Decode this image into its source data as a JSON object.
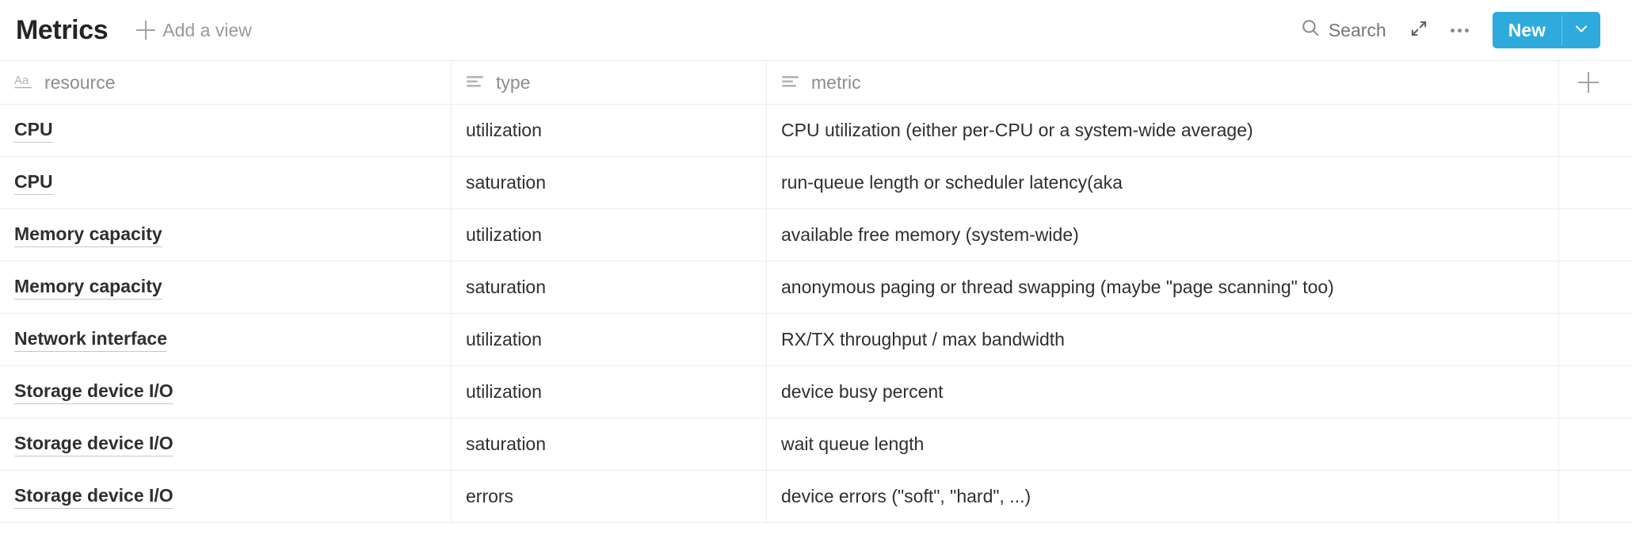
{
  "toolbar": {
    "view_title": "Metrics",
    "add_view_label": "Add a view",
    "add_view_icon": "plus-icon",
    "search_label": "Search",
    "search_icon": "search-icon",
    "expand_icon": "expand-diagonal-arrows-icon",
    "more_icon": "ellipsis-icon",
    "new_label": "New",
    "new_caret_icon": "chevron-down-icon",
    "accent_color": "#2eaadc"
  },
  "table": {
    "columns": [
      {
        "label": "resource",
        "icon": "title-text-aa-icon",
        "type": "title"
      },
      {
        "label": "type",
        "icon": "text-property-icon",
        "type": "text"
      },
      {
        "label": "metric",
        "icon": "text-property-icon",
        "type": "text"
      }
    ],
    "add_column_icon": "plus-icon",
    "rows": [
      {
        "resource": "CPU",
        "type": "utilization",
        "metric": "CPU utilization (either per-CPU or a system-wide average)"
      },
      {
        "resource": "CPU",
        "type": "saturation",
        "metric": "run-queue length or scheduler latency(aka"
      },
      {
        "resource": "Memory capacity",
        "type": "utilization",
        "metric": "available free memory (system-wide)"
      },
      {
        "resource": "Memory capacity",
        "type": "saturation",
        "metric": "anonymous paging or thread swapping (maybe \"page scanning\" too)"
      },
      {
        "resource": "Network interface",
        "type": "utilization",
        "metric": "RX/TX throughput / max bandwidth"
      },
      {
        "resource": "Storage device I/O",
        "type": "utilization",
        "metric": "device busy percent"
      },
      {
        "resource": "Storage device I/O",
        "type": "saturation",
        "metric": "wait queue length"
      },
      {
        "resource": "Storage device I/O",
        "type": "errors",
        "metric": "device errors (\"soft\", \"hard\", ...)"
      }
    ]
  }
}
